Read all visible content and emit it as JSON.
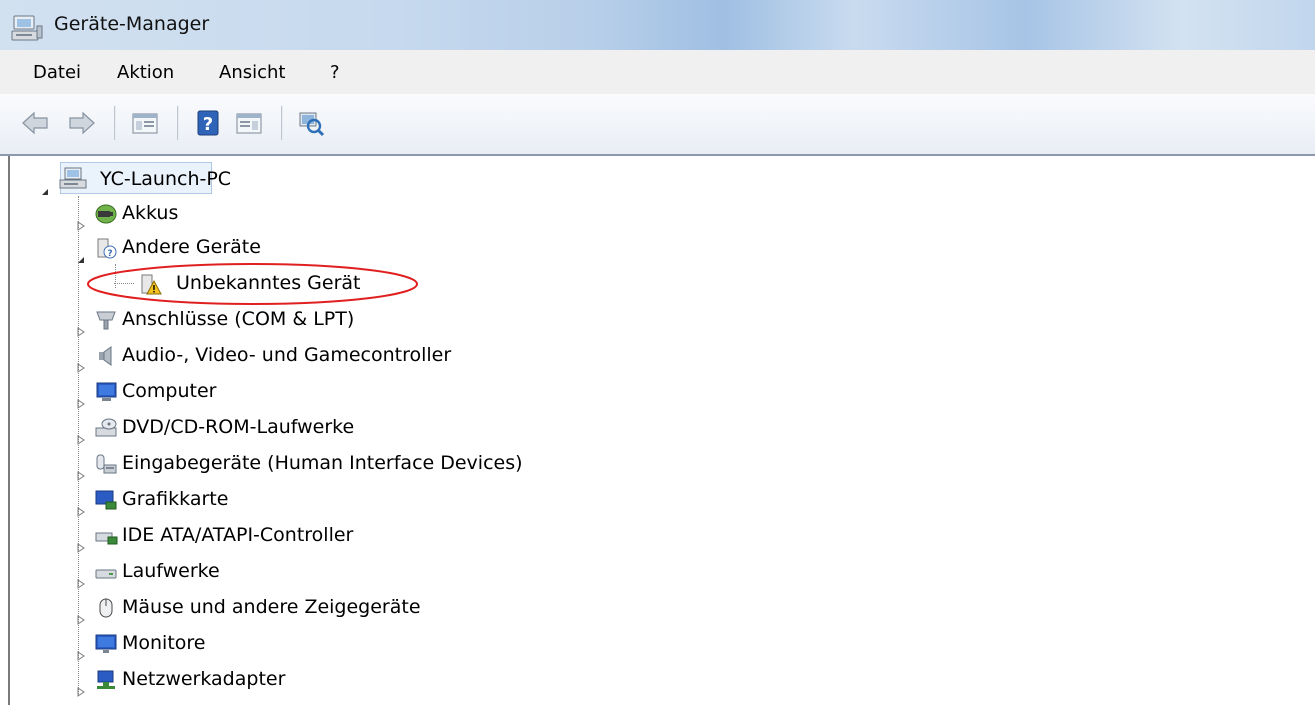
{
  "window": {
    "title": "Geräte-Manager",
    "app_icon": "device-manager-icon"
  },
  "menu": {
    "items": [
      "Datei",
      "Aktion",
      "Ansicht",
      "?"
    ]
  },
  "toolbar": {
    "buttons": [
      {
        "name": "back",
        "icon": "arrow-left-icon"
      },
      {
        "name": "forward",
        "icon": "arrow-right-icon"
      },
      {
        "name": "show-hide-console-tree",
        "icon": "console-tree-icon"
      },
      {
        "name": "help",
        "icon": "help-icon"
      },
      {
        "name": "show-hide-action-pane",
        "icon": "action-pane-icon"
      },
      {
        "name": "scan-hardware",
        "icon": "scan-hardware-icon"
      }
    ]
  },
  "tree": {
    "root": {
      "label": "YC-Launch-PC",
      "icon": "computer-network-icon",
      "expanded": true
    },
    "nodes": [
      {
        "label": "Akkus",
        "icon": "battery-icon",
        "expanded": false
      },
      {
        "label": "Andere Geräte",
        "icon": "unknown-device-icon",
        "expanded": true,
        "children": [
          {
            "label": "Unbekanntes Gerät",
            "icon": "warning-device-icon",
            "highlighted": true
          }
        ]
      },
      {
        "label": "Anschlüsse (COM & LPT)",
        "icon": "port-icon",
        "expanded": false
      },
      {
        "label": "Audio-, Video- und Gamecontroller",
        "icon": "speaker-icon",
        "expanded": false
      },
      {
        "label": "Computer",
        "icon": "computer-icon",
        "expanded": false
      },
      {
        "label": "DVD/CD-ROM-Laufwerke",
        "icon": "dvd-drive-icon",
        "expanded": false
      },
      {
        "label": "Eingabegeräte (Human Interface Devices)",
        "icon": "hid-icon",
        "expanded": false
      },
      {
        "label": "Grafikkarte",
        "icon": "display-adapter-icon",
        "expanded": false
      },
      {
        "label": "IDE ATA/ATAPI-Controller",
        "icon": "ide-controller-icon",
        "expanded": false
      },
      {
        "label": "Laufwerke",
        "icon": "disk-drive-icon",
        "expanded": false
      },
      {
        "label": "Mäuse und andere Zeigegeräte",
        "icon": "mouse-icon",
        "expanded": false
      },
      {
        "label": "Monitore",
        "icon": "monitor-icon",
        "expanded": false
      },
      {
        "label": "Netzwerkadapter",
        "icon": "network-adapter-icon",
        "expanded": false
      }
    ]
  },
  "colors": {
    "highlight_ellipse": "#e02020",
    "selection_bg": "#eaf2fb"
  }
}
